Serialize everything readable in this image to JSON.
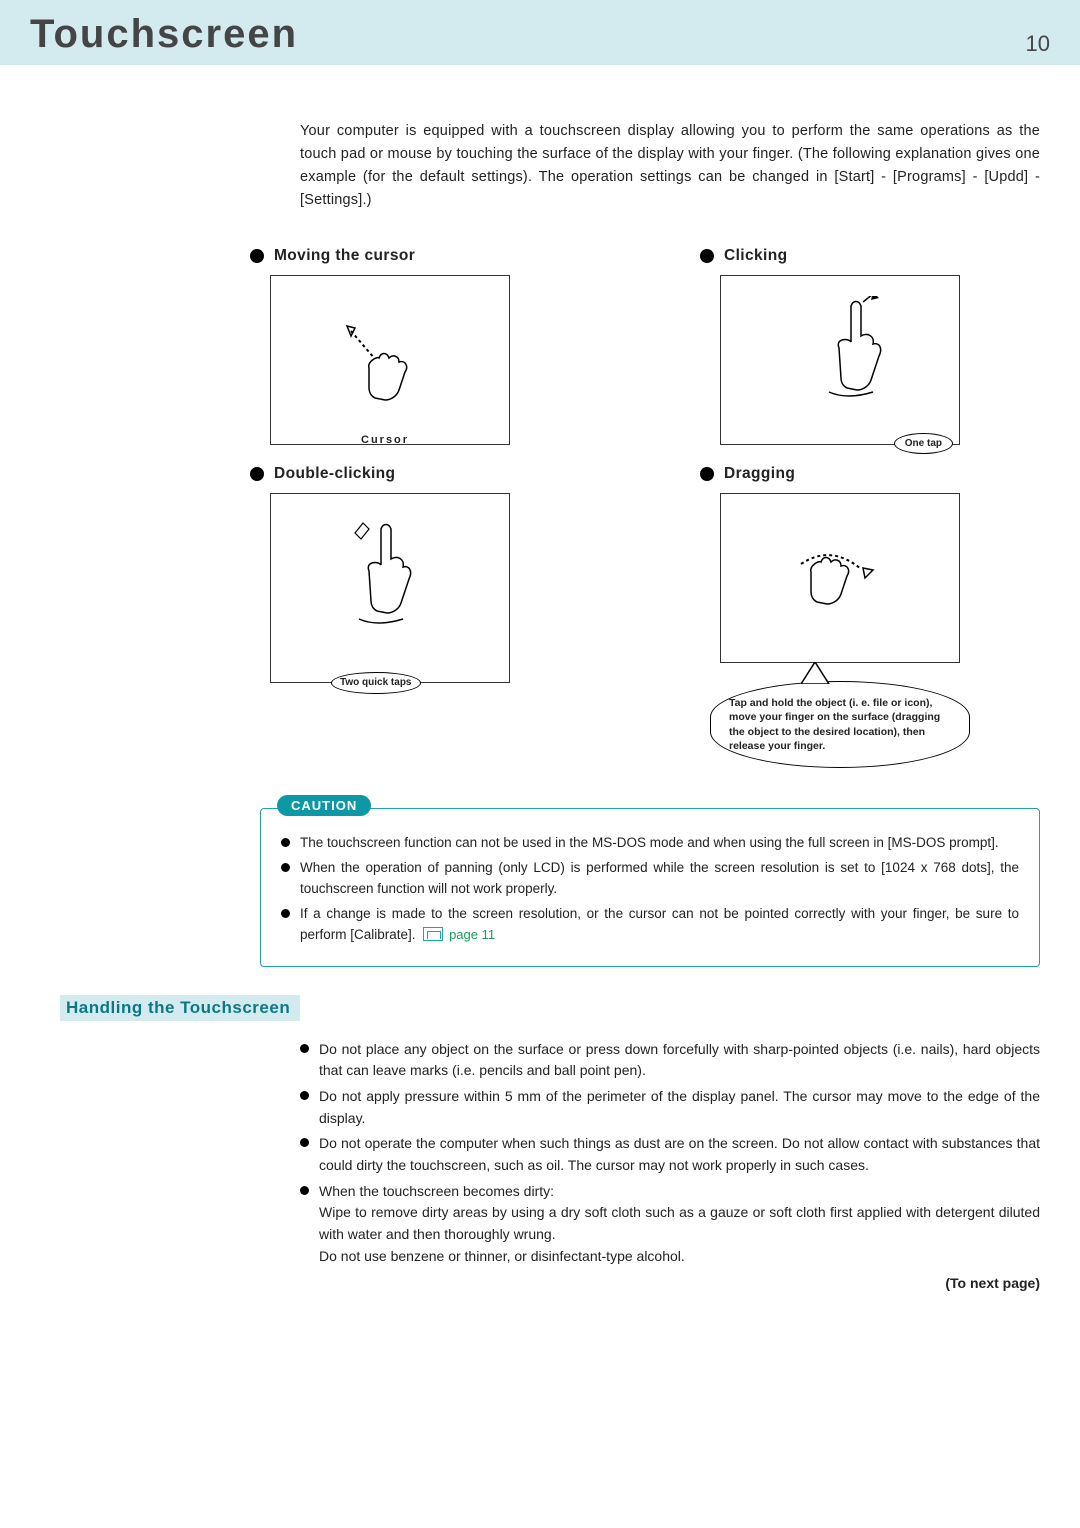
{
  "header": {
    "title": "Touchscreen",
    "page_no": "10"
  },
  "intro": "Your computer is equipped with a touchscreen display allowing you to perform the same operations as the touch pad or mouse by touching the surface of the display with your finger. (The following explanation gives one example (for the default settings). The operation settings can be changed in [Start] - [Programs] - [Updd] - [Settings].)",
  "gestures": {
    "moving": {
      "label": "Moving the cursor",
      "callout": "Cursor"
    },
    "clicking": {
      "label": "Clicking",
      "callout": "One tap"
    },
    "double_clicking": {
      "label": "Double-clicking",
      "callout": "Two quick taps"
    },
    "dragging": {
      "label": "Dragging",
      "callout": "Tap and hold the object (i. e. file or icon), move your finger on the surface (dragging the object to the desired location), then release your finger."
    }
  },
  "caution": {
    "tag": "CAUTION",
    "items": [
      "The touchscreen function can not be used in the MS-DOS mode and when using the full screen in [MS-DOS prompt].",
      "When the operation of panning (only LCD) is performed while the screen resolution is set to [1024 x 768 dots], the touchscreen function will not work properly.",
      "If a change is made to the screen resolution, or the cursor can not be pointed correctly with your finger, be sure to perform [Calibrate]."
    ],
    "page_ref": "page 11"
  },
  "subtitle": "Handling the Touchscreen",
  "handling": [
    "Do not place any object on the surface or press down forcefully with sharp-pointed objects (i.e. nails), hard objects that can leave marks (i.e. pencils and ball point pen).",
    "Do not apply pressure within 5 mm of the perimeter of the display panel.  The cursor may move to the edge of the display.",
    "Do not operate the computer when such things as dust are on the screen.  Do not allow contact with substances that could dirty the touchscreen, such as oil.  The cursor may not work properly in such cases.",
    "When the touchscreen becomes dirty:\nWipe to remove dirty areas by using a dry soft cloth such as a gauze or soft cloth first applied with detergent diluted with water and then thoroughly wrung.\nDo not use benzene or thinner, or disinfectant-type alcohol."
  ],
  "next_page": "(To next page)"
}
